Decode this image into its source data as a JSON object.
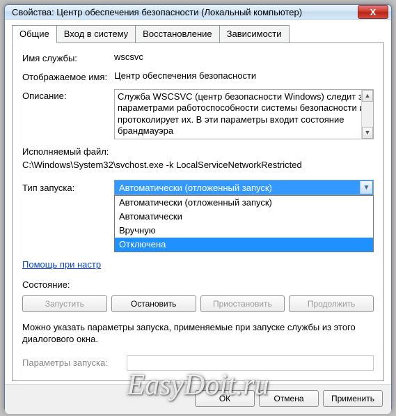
{
  "window": {
    "title": "Свойства: Центр обеспечения безопасности (Локальный компьютер)"
  },
  "tabs": {
    "items": [
      "Общие",
      "Вход в систему",
      "Восстановление",
      "Зависимости"
    ],
    "active": 0
  },
  "general": {
    "service_name_label": "Имя службы:",
    "service_name": "wscsvc",
    "display_name_label": "Отображаемое имя:",
    "display_name": "Центр обеспечения безопасности",
    "description_label": "Описание:",
    "description": "Служба WSCSVC (центр безопасности Windows) следит за параметрами работоспособности системы безопасности и протоколирует их. В эти параметры входит состояние брандмауэра",
    "exe_label": "Исполняемый файл:",
    "exe_path": "C:\\Windows\\System32\\svchost.exe -k LocalServiceNetworkRestricted",
    "startup_label": "Тип запуска:",
    "startup_selected": "Автоматически (отложенный запуск)",
    "startup_options": [
      "Автоматически (отложенный запуск)",
      "Автоматически",
      "Вручную",
      "Отключена"
    ],
    "startup_highlight_index": 3,
    "help_link": "Помощь при настр",
    "state_label": "Состояние:",
    "buttons": {
      "start": "Запустить",
      "stop": "Остановить",
      "pause": "Приостановить",
      "resume": "Продолжить"
    },
    "note": "Можно указать параметры запуска, применяемые при запуске службы из этого диалогового окна.",
    "params_label": "Параметры запуска:"
  },
  "footer": {
    "ok": "ОК",
    "cancel": "Отмена",
    "apply": "Применить"
  },
  "watermark": "EasyDoit.ru"
}
